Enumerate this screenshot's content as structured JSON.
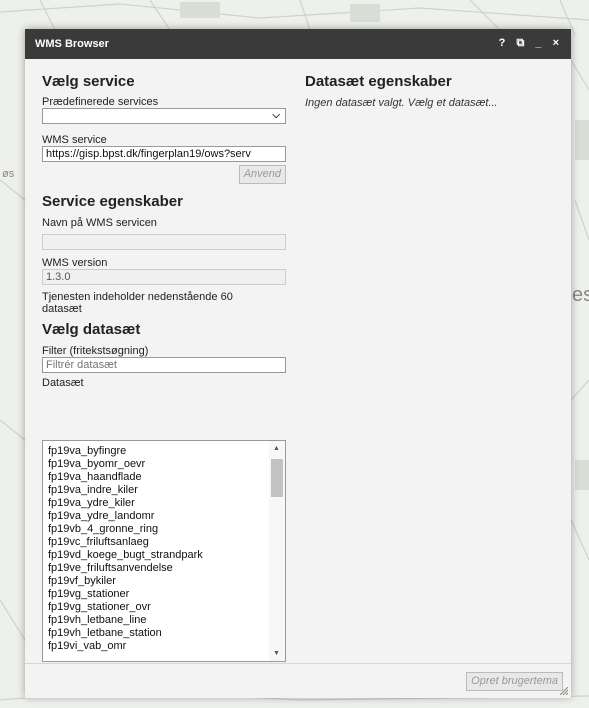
{
  "dialog": {
    "title": "WMS Browser",
    "controls": {
      "help": "?",
      "dock": "⧉",
      "minimize": "_",
      "close": "×"
    }
  },
  "left": {
    "service_heading": "Vælg service",
    "predefined_label": "Prædefinerede services",
    "predefined_value": "",
    "wms_service_label": "WMS service",
    "wms_service_value": "https://gisp.bpst.dk/fingerplan19/ows?serv",
    "apply_button": "Anvend",
    "props_heading": "Service egenskaber",
    "name_label": "Navn på WMS servicen",
    "name_value": "",
    "version_label": "WMS version",
    "version_value": "1.3.0",
    "contains_text": "Tjenesten indeholder nedenstående 60 datasæt",
    "dataset_heading": "Vælg datasæt",
    "filter_label": "Filter (fritekstsøgning)",
    "filter_placeholder": "Filtrér datasæt",
    "datasets_label": "Datasæt",
    "datasets": [
      "fp19va_byfingre",
      "fp19va_byomr_oevr",
      "fp19va_haandflade",
      "fp19va_indre_kiler",
      "fp19va_ydre_kiler",
      "fp19va_ydre_landomr",
      "fp19vb_4_gronne_ring",
      "fp19vc_friluftsanlaeg",
      "fp19vd_koege_bugt_strandpark",
      "fp19ve_friluftsanvendelse",
      "fp19vf_bykiler",
      "fp19vg_stationer",
      "fp19vg_stationer_ovr",
      "fp19vh_letbane_line",
      "fp19vh_letbane_station",
      "fp19vi_vab_omr"
    ]
  },
  "right": {
    "heading": "Datasæt egenskaber",
    "empty_text": "Ingen datasæt valgt. Vælg et datasæt..."
  },
  "footer": {
    "create_button": "Opret brugertema"
  },
  "map": {
    "label_left": "øs",
    "label_right": "es"
  }
}
